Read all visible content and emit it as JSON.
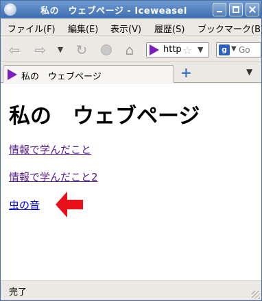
{
  "window": {
    "title": "私の　ウェブページ - Iceweasel"
  },
  "menubar": {
    "items": [
      "ファイル(F)",
      "編集(E)",
      "表示(V)",
      "履歴(S)",
      "ブックマーク(B)"
    ]
  },
  "navbar": {
    "url_text": "http",
    "search_placeholder": "Go"
  },
  "tabs": [
    {
      "label": "私の　ウェブページ"
    }
  ],
  "page": {
    "heading": "私の　ウェブページ",
    "links": [
      "情報で学んだこと",
      "情報で学んだこと2",
      "虫の音"
    ],
    "arrow_color": "#e8101a"
  },
  "status": {
    "text": "完了"
  },
  "icons": {
    "site": "purple-play-icon",
    "search_engine": "google-g-icon",
    "annotation": "red-left-arrow"
  }
}
